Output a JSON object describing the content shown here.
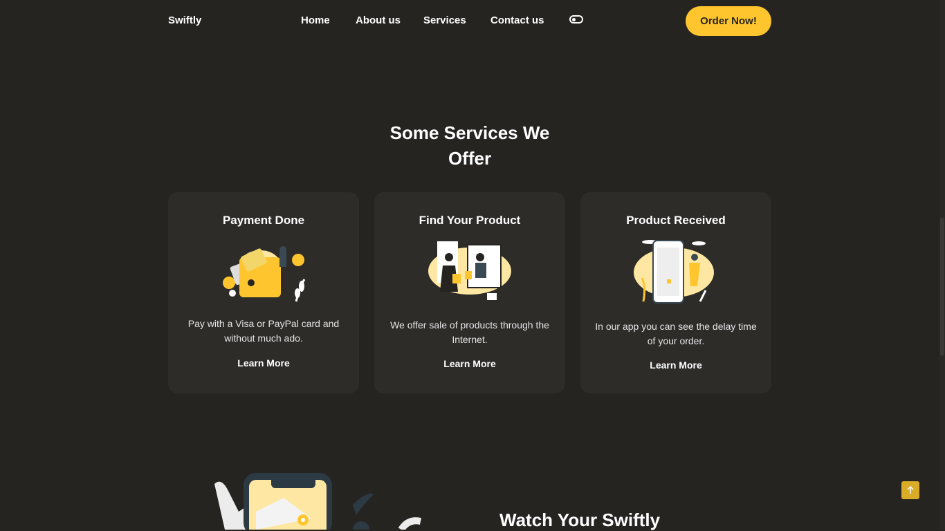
{
  "brand": {
    "logo": "Swiftly"
  },
  "nav": {
    "items": [
      {
        "label": "Home"
      },
      {
        "label": "About us"
      },
      {
        "label": "Services"
      },
      {
        "label": "Contact us"
      }
    ],
    "theme_toggle_icon": "toggle-icon",
    "order_button": "Order Now!"
  },
  "colors": {
    "accent": "#fec52e",
    "background": "#252421",
    "card": "#2d2c29"
  },
  "services": {
    "title": "Some Services We Offer",
    "cards": [
      {
        "title": "Payment Done",
        "description": "Pay with a Visa or PayPal card and without much ado.",
        "link": "Learn More",
        "illustration": "wallet-illustration"
      },
      {
        "title": "Find Your Product",
        "description": "We offer sale of products through the Internet.",
        "link": "Learn More",
        "illustration": "shopping-illustration"
      },
      {
        "title": "Product Received",
        "description": "In our app you can see the delay time of your order.",
        "link": "Learn More",
        "illustration": "phone-delivery-illustration"
      }
    ]
  },
  "next_section": {
    "title": "Watch Your Swiftly",
    "illustration": "phone-map-illustration"
  },
  "back_to_top_icon": "arrow-up-icon"
}
